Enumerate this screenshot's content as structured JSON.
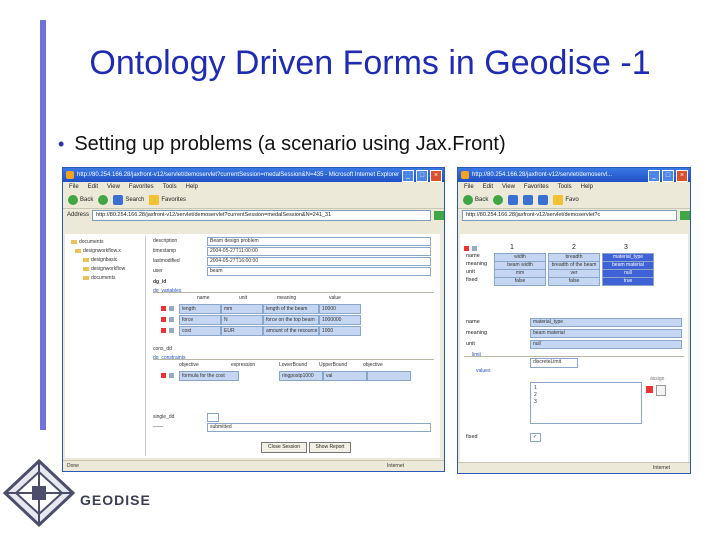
{
  "slide": {
    "title": "Ontology Driven Forms in Geodise -1",
    "bullet": "Setting up problems (a scenario using Jax.Front)",
    "logo_text": "GEODISE"
  },
  "left_window": {
    "title": "http://80.254.166.28/jaxfront-v12/servlet/demoservlet?currentSession=medalSession&N=435 - Microsoft Internet Explorer",
    "menu": [
      "File",
      "Edit",
      "View",
      "Favorites",
      "Tools",
      "Help"
    ],
    "toolbar": {
      "back": "Back",
      "search": "Search",
      "favorites": "Favorites"
    },
    "address_label": "Address",
    "address": "http://80.254.166.28/jaxfront-v12/servlet/demoservlet?currentSession=medalSession&N=241_31",
    "tree": [
      "documents",
      "designworkflow.x",
      "designbasic",
      "designworkflow",
      "documents"
    ],
    "form_labels": {
      "description": "description",
      "timestamp": "timestamp",
      "lastmodified": "lastmodified",
      "user": "user",
      "dg_id": "dg_id",
      "dg_variables": "dg_variables",
      "dg_constraints": "dg_constraints",
      "cons_dd": "cons_dd",
      "single_dd": "single_dd"
    },
    "form_values": {
      "description": "Beam design problem",
      "timestamp": "2004-05-27T11:00:00",
      "lastmodified": "2004-05-27T16:00:00",
      "user": "beam",
      "constraints_name": "formula for the cost",
      "constraints_pre": "ringpostp1000",
      "constraints_val": "val",
      "single": "submitted"
    },
    "var_headers": [
      "name",
      "unit",
      "meaning",
      "value"
    ],
    "var_rows": [
      {
        "name": "length",
        "unit": "mm",
        "meaning": "length of the beam",
        "value": "10000"
      },
      {
        "name": "force",
        "unit": "N",
        "meaning": "force on the top beam",
        "value": "1000000"
      },
      {
        "name": "cost",
        "unit": "EUR",
        "meaning": "amount of the resource",
        "value": "1000"
      }
    ],
    "cons_headers": [
      "objective",
      "expression",
      "LowerBound",
      "UpperBound",
      "objective"
    ],
    "buttons": {
      "show_report": "Show Report",
      "close": "Close Session"
    },
    "status": "Done",
    "status_zone": "Internet"
  },
  "right_window": {
    "title": "http://80.254.166.28/jaxfront-v12/servlet/demoservl...",
    "menu": [
      "File",
      "Edit",
      "View",
      "Favorites",
      "Tools",
      "Help"
    ],
    "toolbar": {
      "back": "Back",
      "favorites": "Favo"
    },
    "address": "http://80.254.166.28/jaxfront-v12/servlet/demoservlet?c",
    "col_headers": [
      "1",
      "2",
      "3"
    ],
    "row_labels": [
      "name",
      "meaning",
      "unit",
      "fixed"
    ],
    "grid": [
      [
        "width",
        "breadth",
        "material_type"
      ],
      [
        "beam width",
        "breadth of the beam",
        "beam material"
      ],
      [
        "mm",
        "ver",
        "null"
      ],
      [
        "false",
        "false",
        "true"
      ]
    ],
    "detail_labels": [
      "name",
      "meaning",
      "unit",
      "limit",
      "values"
    ],
    "detail_values": {
      "name": "material_type",
      "meaning": "beam material",
      "unit": "null"
    },
    "discrete_limit": "discreteLimit",
    "value_list": [
      "1",
      "2",
      "3"
    ],
    "fixed_label": "fixed",
    "assign_label": "assign",
    "status_zone": "Internet"
  },
  "colors": {
    "title": "#1f2bb3",
    "accent_bar": "#6f72d8",
    "xp_titlebar": "#2455d0",
    "form_cell": "#c5d6f2",
    "selected_cell": "#3f63d6"
  }
}
